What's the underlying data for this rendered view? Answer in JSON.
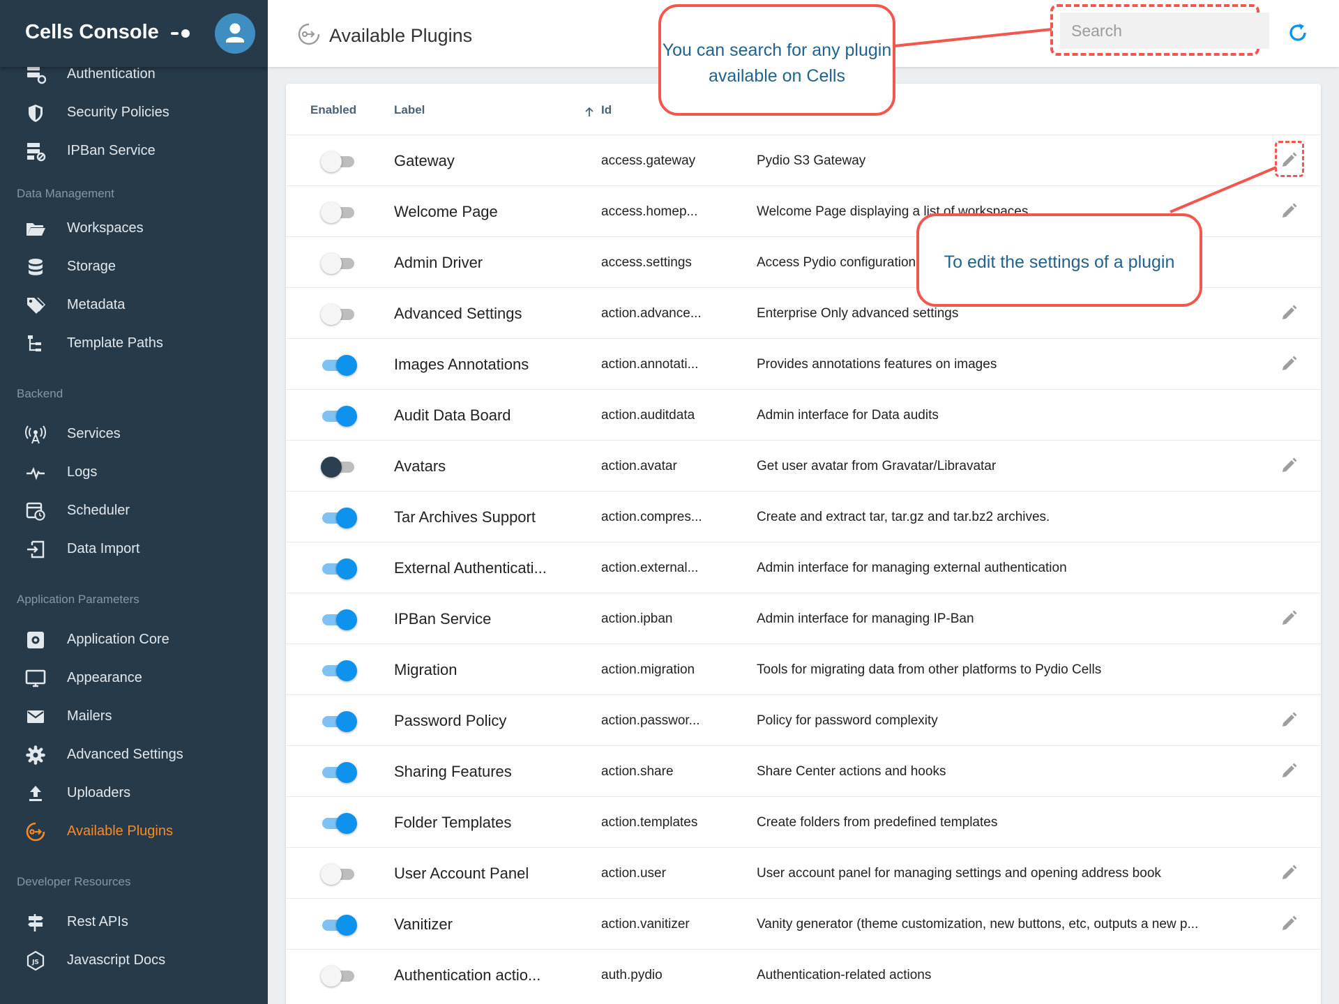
{
  "app": {
    "title": "Cells Console"
  },
  "sidebar": {
    "items": [
      {
        "label": "Authentication",
        "icon": "authentication-icon"
      },
      {
        "label": "Security Policies",
        "icon": "shield-icon"
      },
      {
        "label": "IPBan Service",
        "icon": "ipban-icon"
      },
      {
        "label": "Workspaces",
        "icon": "folder-open-icon"
      },
      {
        "label": "Storage",
        "icon": "database-icon"
      },
      {
        "label": "Metadata",
        "icon": "tags-icon"
      },
      {
        "label": "Template Paths",
        "icon": "file-tree-icon"
      },
      {
        "label": "Services",
        "icon": "antenna-icon"
      },
      {
        "label": "Logs",
        "icon": "pulse-icon"
      },
      {
        "label": "Scheduler",
        "icon": "calendar-clock-icon"
      },
      {
        "label": "Data Import",
        "icon": "import-icon"
      },
      {
        "label": "Application Core",
        "icon": "chip-icon"
      },
      {
        "label": "Appearance",
        "icon": "monitor-icon"
      },
      {
        "label": "Mailers",
        "icon": "mail-icon"
      },
      {
        "label": "Advanced Settings",
        "icon": "gear-icon"
      },
      {
        "label": "Uploaders",
        "icon": "upload-icon"
      },
      {
        "label": "Available Plugins",
        "icon": "plugin-icon",
        "active": true
      },
      {
        "label": "Rest APIs",
        "icon": "signpost-icon"
      },
      {
        "label": "Javascript Docs",
        "icon": "nodejs-icon"
      }
    ],
    "sections": [
      "Data Management",
      "Backend",
      "Application Parameters",
      "Developer Resources"
    ]
  },
  "header": {
    "title": "Available Plugins",
    "search_placeholder": "Search"
  },
  "table": {
    "columns": {
      "enabled": "Enabled",
      "label": "Label",
      "id": "Id"
    },
    "rows": [
      {
        "enabled": "off",
        "label": "Gateway",
        "id": "access.gateway",
        "description": "Pydio S3 Gateway",
        "editable": true
      },
      {
        "enabled": "off",
        "label": "Welcome Page",
        "id": "access.homep...",
        "description": "Welcome Page displaying a list of workspaces",
        "editable": true
      },
      {
        "enabled": "off",
        "label": "Admin Driver",
        "id": "access.settings",
        "description": "Access Pydio configuration",
        "editable": false
      },
      {
        "enabled": "off",
        "label": "Advanced Settings",
        "id": "action.advance...",
        "description": "Enterprise Only advanced settings",
        "editable": true
      },
      {
        "enabled": "on",
        "label": "Images Annotations",
        "id": "action.annotati...",
        "description": "Provides annotations features on images",
        "editable": true
      },
      {
        "enabled": "on",
        "label": "Audit Data Board",
        "id": "action.auditdata",
        "description": "Admin interface for Data audits",
        "editable": false
      },
      {
        "enabled": "dark",
        "label": "Avatars",
        "id": "action.avatar",
        "description": "Get user avatar from Gravatar/Libravatar",
        "editable": true
      },
      {
        "enabled": "on",
        "label": "Tar Archives Support",
        "id": "action.compres...",
        "description": "Create and extract tar, tar.gz and tar.bz2 archives.",
        "editable": false
      },
      {
        "enabled": "on",
        "label": "External Authenticati...",
        "id": "action.external...",
        "description": "Admin interface for managing external authentication",
        "editable": false
      },
      {
        "enabled": "on",
        "label": "IPBan Service",
        "id": "action.ipban",
        "description": "Admin interface for managing IP-Ban",
        "editable": true
      },
      {
        "enabled": "on",
        "label": "Migration",
        "id": "action.migration",
        "description": "Tools for migrating data from other platforms to Pydio Cells",
        "editable": false
      },
      {
        "enabled": "on",
        "label": "Password Policy",
        "id": "action.passwor...",
        "description": "Policy for password complexity",
        "editable": true
      },
      {
        "enabled": "on",
        "label": "Sharing Features",
        "id": "action.share",
        "description": "Share Center actions and hooks",
        "editable": true
      },
      {
        "enabled": "on",
        "label": "Folder Templates",
        "id": "action.templates",
        "description": "Create folders from predefined templates",
        "editable": false
      },
      {
        "enabled": "off",
        "label": "User Account Panel",
        "id": "action.user",
        "description": "User account panel for managing settings and opening address book",
        "editable": true
      },
      {
        "enabled": "on",
        "label": "Vanitizer",
        "id": "action.vanitizer",
        "description": "Vanity generator (theme customization, new buttons, etc, outputs a new p...",
        "editable": true
      },
      {
        "enabled": "off",
        "label": "Authentication actio...",
        "id": "auth.pydio",
        "description": "Authentication-related actions",
        "editable": false
      }
    ]
  },
  "annotations": {
    "search_callout": "You can search for any plugin available on Cells",
    "edit_callout": "To edit the settings of a plugin"
  },
  "colors": {
    "sidebar_bg": "#263a4a",
    "active_accent": "#ff8a1f",
    "toggle_on": "#0d93ee",
    "annotation_red": "#f2574d",
    "annotation_text": "#20638f"
  }
}
